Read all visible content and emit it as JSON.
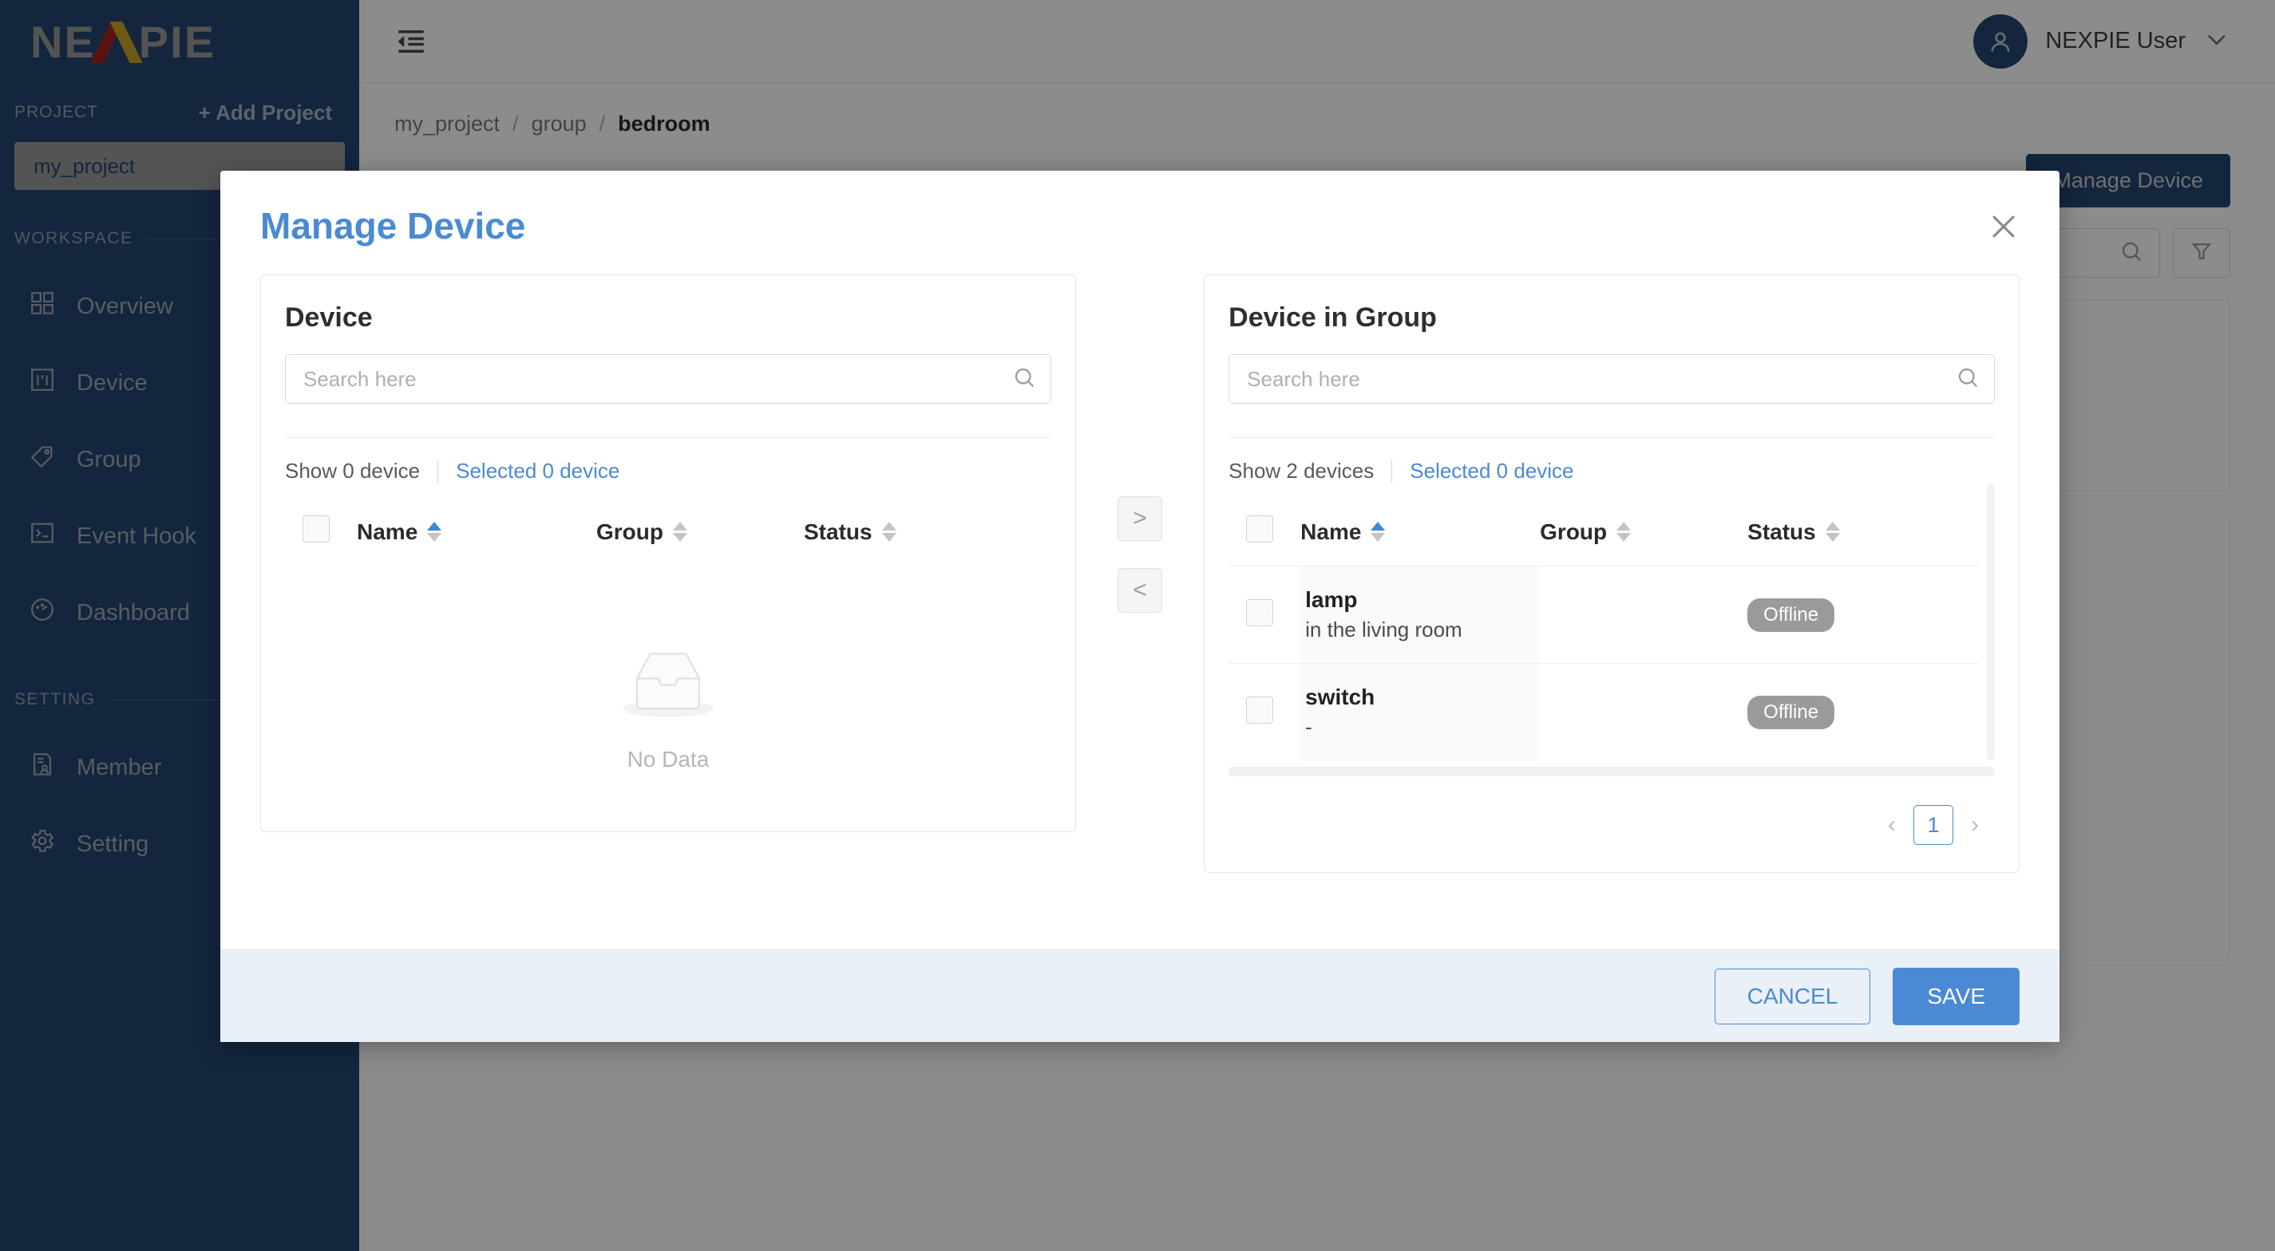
{
  "brand": {
    "name_left": "NE",
    "name_x": "X",
    "name_right": "PIE"
  },
  "sidebar": {
    "project_label": "PROJECT",
    "add_project_label": "+ Add Project",
    "current_project": "my_project",
    "workspace_label": "WORKSPACE",
    "setting_label": "SETTING",
    "workspace_items": [
      {
        "label": "Overview",
        "icon": "grid-icon"
      },
      {
        "label": "Device",
        "icon": "device-icon"
      },
      {
        "label": "Group",
        "icon": "tag-icon"
      },
      {
        "label": "Event Hook",
        "icon": "console-icon"
      },
      {
        "label": "Dashboard",
        "icon": "gauge-icon"
      }
    ],
    "setting_items": [
      {
        "label": "Member",
        "icon": "member-icon"
      },
      {
        "label": "Setting",
        "icon": "gear-icon"
      }
    ]
  },
  "topbar": {
    "fold_icon": "menu-fold-icon",
    "user_name": "NEXPIE User",
    "avatar_icon": "user-avatar-icon",
    "chevron": "chevron-down-icon"
  },
  "breadcrumb": {
    "items": [
      "my_project",
      "group"
    ],
    "current": "bedroom",
    "separator": "/"
  },
  "page_actions": {
    "manage_device_label": "Manage Device",
    "search_icon": "search-icon",
    "filter_icon": "filter-icon"
  },
  "modal": {
    "title": "Manage Device",
    "close_icon": "close-icon",
    "left_panel": {
      "title": "Device",
      "search_placeholder": "Search here",
      "search_value": "",
      "search_icon": "search-icon",
      "show_text": "Show 0 device",
      "selected_text": "Selected 0 device",
      "columns": [
        "Name",
        "Group",
        "Status"
      ],
      "sort_column": "Name",
      "sort_direction": "asc",
      "rows": [],
      "empty_label": "No Data",
      "empty_icon": "inbox-icon"
    },
    "transfer": {
      "to_right_icon": "chevron-right-icon",
      "to_left_icon": "chevron-left-icon",
      "to_right_label": ">",
      "to_left_label": "<"
    },
    "right_panel": {
      "title": "Device in Group",
      "search_placeholder": "Search here",
      "search_value": "",
      "search_icon": "search-icon",
      "show_text": "Show 2 devices",
      "selected_text": "Selected 0 device",
      "columns": [
        "Name",
        "Group",
        "Status"
      ],
      "sort_column": "Name",
      "sort_direction": "asc",
      "rows": [
        {
          "name": "lamp",
          "description": "in the living room",
          "group": "",
          "status": "Offline"
        },
        {
          "name": "switch",
          "description": "-",
          "group": "",
          "status": "Offline"
        }
      ],
      "pagination": {
        "prev": "‹",
        "page": "1",
        "next": "›"
      }
    },
    "footer": {
      "cancel_label": "CANCEL",
      "save_label": "SAVE"
    }
  },
  "colors": {
    "sidebar_bg": "#24456f",
    "accent_blue": "#4a8ad4",
    "status_offline": "#9a9a9a",
    "logo_red": "#a62421",
    "logo_gold": "#c9a227"
  }
}
